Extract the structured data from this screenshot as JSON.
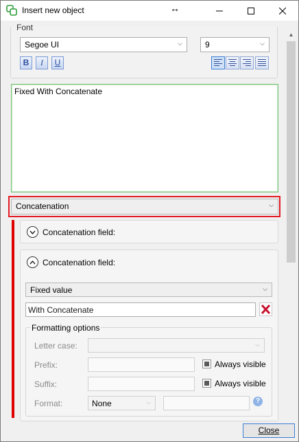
{
  "window": {
    "title": "Insert new object",
    "move_glyph": "↔"
  },
  "font": {
    "legend": "Font",
    "name": "Segoe UI",
    "size": "9",
    "bold_label": "B",
    "italic_label": "I",
    "underline_label": "U"
  },
  "text_content": "Fixed With Concatenate",
  "object_type": "Concatenation",
  "panels": [
    {
      "label": "Concatenation field:",
      "state": "collapsed"
    },
    {
      "label": "Concatenation field:",
      "state": "expanded"
    }
  ],
  "field": {
    "source": "Fixed value",
    "value": "With Concatenate"
  },
  "formatting": {
    "legend": "Formatting options",
    "letter_case_label": "Letter case:",
    "letter_case_value": "",
    "prefix_label": "Prefix:",
    "suffix_label": "Suffix:",
    "always_visible_label": "Always visible",
    "format_label": "Format:",
    "format_value": "None",
    "help_glyph": "?"
  },
  "footer": {
    "close_label": "Close"
  },
  "colors": {
    "highlight": "#e31b23",
    "accent": "#3c7fd4"
  }
}
